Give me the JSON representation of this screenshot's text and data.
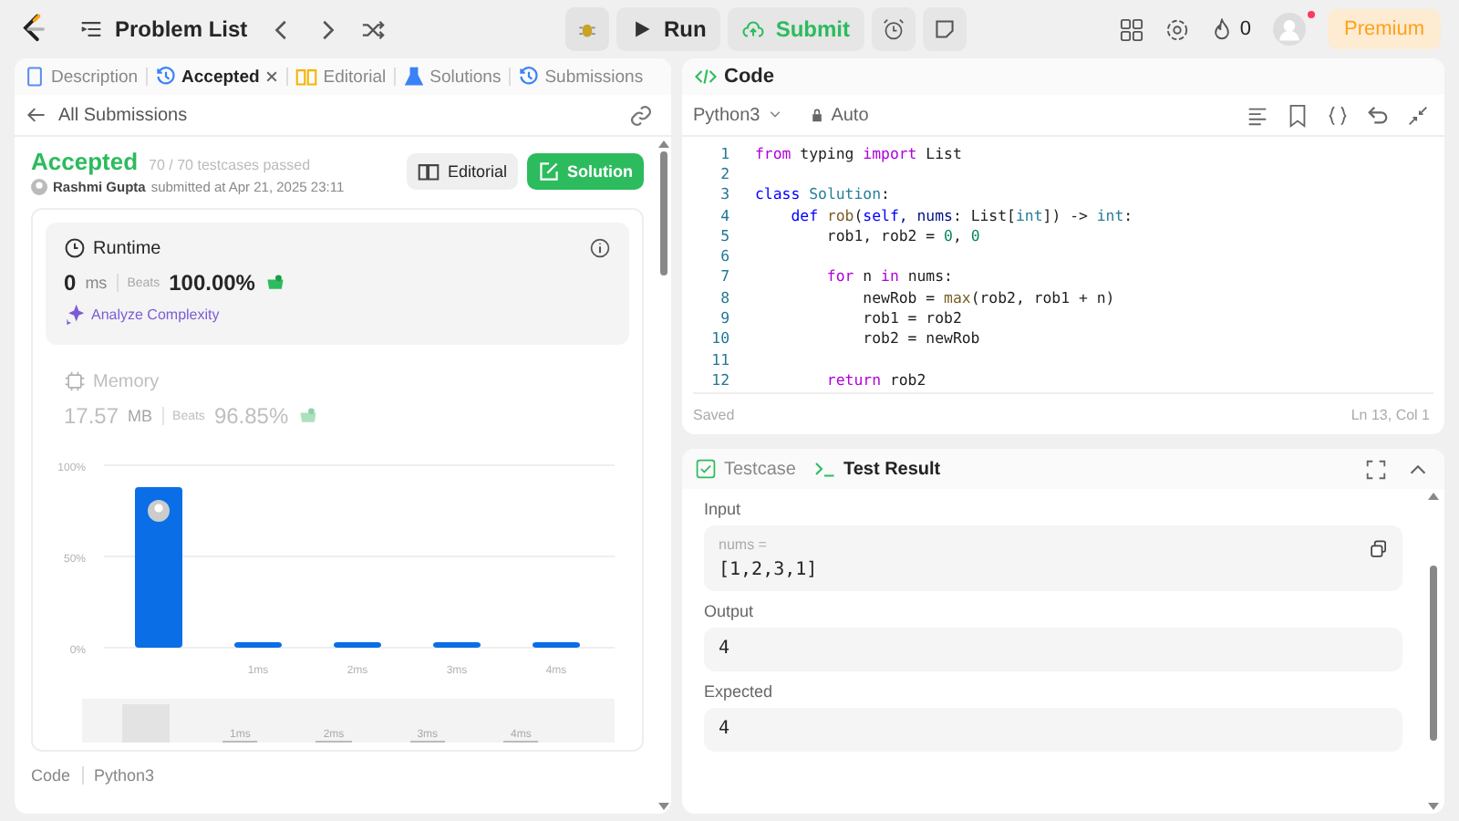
{
  "top_bar": {
    "title": "Problem List",
    "run": "Run",
    "submit": "Submit",
    "streak": "0",
    "premium": "Premium",
    "notification": true
  },
  "left_tabs": [
    {
      "label": "Description",
      "selected": false,
      "kind": "doc",
      "color": "#5b8def"
    },
    {
      "label": "Accepted",
      "selected": true,
      "kind": "history",
      "color": "#3b82f6",
      "closable": true
    },
    {
      "label": "Editorial",
      "selected": false,
      "kind": "book",
      "color": "#f5b400"
    },
    {
      "label": "Solutions",
      "selected": false,
      "kind": "flask",
      "color": "#3b82f6"
    },
    {
      "label": "Submissions",
      "selected": false,
      "kind": "history",
      "color": "#3b82f6"
    }
  ],
  "submission": {
    "back": "All Submissions",
    "status": "Accepted",
    "passed": "70 / 70 testcases passed",
    "author": "Rashmi Gupta",
    "submitted": "submitted at Apr 21, 2025 23:11",
    "editorial_button": "Editorial",
    "solution_button": "Solution",
    "runtime": {
      "title": "Runtime",
      "value": "0",
      "unit": "ms",
      "beats_label": "Beats",
      "beats": "100.00%",
      "analyze": "Analyze Complexity"
    },
    "memory": {
      "title": "Memory",
      "value": "17.57",
      "unit": "MB",
      "beats_label": "Beats",
      "beats": "96.85%"
    },
    "chart_data": {
      "type": "bar",
      "categories": [
        null,
        "1ms",
        "2ms",
        "3ms",
        "4ms"
      ],
      "values": [
        88,
        2,
        2,
        3,
        2
      ],
      "ylim": [
        0,
        100
      ],
      "yticks": [
        {
          "value": 0,
          "label": "0%"
        },
        {
          "value": 50,
          "label": "50%"
        },
        {
          "value": 100,
          "label": "100%"
        }
      ]
    },
    "navigator_labels": [
      "1ms",
      "2ms",
      "3ms",
      "4ms"
    ],
    "footer": [
      "Code",
      "Python3"
    ]
  },
  "code_panel": {
    "title": "Code",
    "language": "Python3",
    "mode": "Auto",
    "status": "Saved",
    "cursor": "Ln 13, Col 1",
    "lines": [
      {
        "number": "1",
        "tokens": [
          {
            "t": "from",
            "kind": "kw"
          },
          {
            "t": " typing ",
            "kind": "plain"
          },
          {
            "t": "import",
            "kind": "kw"
          },
          {
            "t": " List",
            "kind": "plain"
          }
        ]
      },
      {
        "number": "2"
      },
      {
        "number": "3",
        "tokens": [
          {
            "t": "class",
            "kind": "def"
          },
          {
            "t": " Solution",
            "kind": "type"
          },
          {
            "t": ":",
            "kind": "plain"
          }
        ]
      },
      {
        "number": "4",
        "tokens": [
          {
            "t": "    def",
            "kind": "def"
          },
          {
            "t": " rob",
            "kind": "fn"
          },
          {
            "t": "(",
            "kind": "plain"
          },
          {
            "t": "self",
            "kind": "def"
          },
          {
            "t": ", nums",
            "kind": "var"
          },
          {
            "t": ": List[",
            "kind": "plain"
          },
          {
            "t": "int",
            "kind": "type"
          },
          {
            "t": "]) -> ",
            "kind": "plain"
          },
          {
            "t": "int",
            "kind": "type"
          },
          {
            "t": ":",
            "kind": "plain"
          }
        ]
      },
      {
        "number": "5",
        "tokens": [
          {
            "t": "        rob1, rob2 = ",
            "kind": "plain"
          },
          {
            "t": "0",
            "kind": "num"
          },
          {
            "t": ", ",
            "kind": "plain"
          },
          {
            "t": "0",
            "kind": "num"
          }
        ]
      },
      {
        "number": "6"
      },
      {
        "number": "7",
        "tokens": [
          {
            "t": "        for",
            "kind": "kw"
          },
          {
            "t": " n ",
            "kind": "plain"
          },
          {
            "t": "in",
            "kind": "kw"
          },
          {
            "t": " nums:",
            "kind": "plain"
          }
        ]
      },
      {
        "number": "8",
        "tokens": [
          {
            "t": "            newRob = ",
            "kind": "plain"
          },
          {
            "t": "max",
            "kind": "fn"
          },
          {
            "t": "(rob2, rob1 + n)",
            "kind": "plain"
          }
        ]
      },
      {
        "number": "9",
        "tokens": [
          {
            "t": "            rob1 = rob2",
            "kind": "plain"
          }
        ]
      },
      {
        "number": "10",
        "tokens": [
          {
            "t": "            rob2 = newRob",
            "kind": "plain"
          }
        ]
      },
      {
        "number": "11"
      },
      {
        "number": "12",
        "tokens": [
          {
            "t": "        return",
            "kind": "kw"
          },
          {
            "t": " rob2",
            "kind": "plain"
          }
        ]
      }
    ]
  },
  "test_panel": {
    "tabs": [
      {
        "label": "Testcase",
        "selected": false,
        "kind": "check"
      },
      {
        "label": "Test Result",
        "selected": true,
        "kind": "terminal"
      }
    ],
    "fields": [
      {
        "label": "Input",
        "name": "nums =",
        "value": "[1,2,3,1]",
        "copy": true
      },
      {
        "label": "Output",
        "value": "4"
      },
      {
        "label": "Expected",
        "value": "4"
      }
    ]
  }
}
